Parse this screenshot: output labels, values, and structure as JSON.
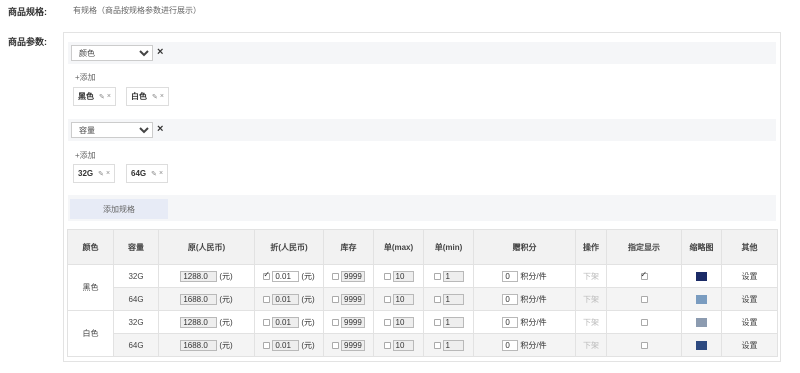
{
  "spec_row": {
    "label": "商品规格:",
    "value": "有规格（商品按规格参数进行展示）"
  },
  "params_label": "商品参数:",
  "spec_groups": [
    {
      "select": "颜色",
      "close": "×",
      "add": "+添加",
      "tags": [
        {
          "text": "黑色",
          "edit_icon": "pencil-icon",
          "remove": "×"
        },
        {
          "text": "白色",
          "edit_icon": "pencil-icon",
          "remove": "×"
        }
      ]
    },
    {
      "select": "容量",
      "close": "×",
      "add": "+添加",
      "tags": [
        {
          "text": "32G",
          "edit_icon": "pencil-icon",
          "remove": "×"
        },
        {
          "text": "64G",
          "edit_icon": "pencil-icon",
          "remove": "×"
        }
      ]
    }
  ],
  "add_spec_button": "添加规格",
  "table": {
    "headers": [
      "颜色",
      "容量",
      "原(人民币)",
      "折(人民币)",
      "库存",
      "单(max)",
      "单(min)",
      "赠积分",
      "操作",
      "指定显示",
      "缩略图",
      "其他"
    ],
    "rows": [
      {
        "color": "黑色",
        "capacity": "32G",
        "orig": "1288.0",
        "orig_unit": "(元)",
        "disc_checked": true,
        "disc": "0.01",
        "disc_unit": "(元)",
        "stock": "9999",
        "max": "10",
        "min": "1",
        "points": "0",
        "points_unit": "积分/件",
        "op": "下架",
        "show": true,
        "thumb_color": "#1a2a66",
        "other": "设置"
      },
      {
        "color": "",
        "capacity": "64G",
        "orig": "1688.0",
        "orig_unit": "(元)",
        "disc_checked": false,
        "disc": "0.01",
        "disc_unit": "(元)",
        "stock": "9999",
        "max": "10",
        "min": "1",
        "points": "0",
        "points_unit": "积分/件",
        "op": "下架",
        "show": false,
        "thumb_color": "#7a9cc0",
        "other": "设置"
      },
      {
        "color": "白色",
        "capacity": "32G",
        "orig": "1288.0",
        "orig_unit": "(元)",
        "disc_checked": false,
        "disc": "0.01",
        "disc_unit": "(元)",
        "stock": "9999",
        "max": "10",
        "min": "1",
        "points": "0",
        "points_unit": "积分/件",
        "op": "下架",
        "show": false,
        "thumb_color": "#8c9bb0",
        "other": "设置"
      },
      {
        "color": "",
        "capacity": "64G",
        "orig": "1688.0",
        "orig_unit": "(元)",
        "disc_checked": false,
        "disc": "0.01",
        "disc_unit": "(元)",
        "stock": "9999",
        "max": "10",
        "min": "1",
        "points": "0",
        "points_unit": "积分/件",
        "op": "下架",
        "show": false,
        "thumb_color": "#2d4a80",
        "other": "设置"
      }
    ]
  }
}
